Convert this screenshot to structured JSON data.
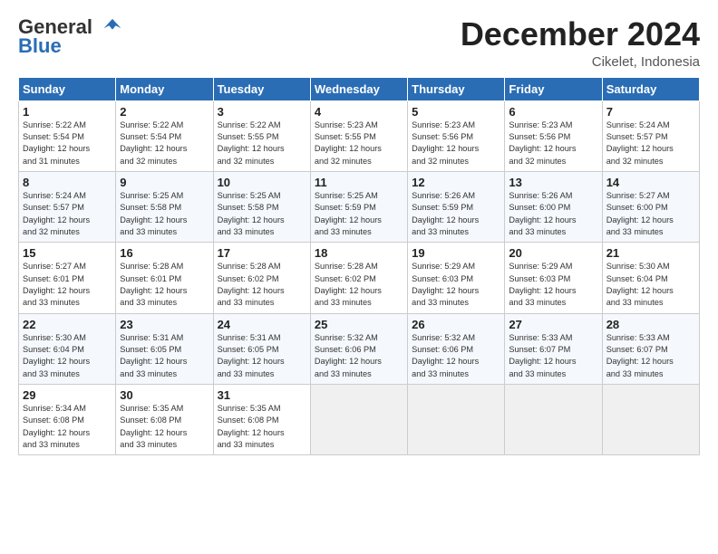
{
  "logo": {
    "line1": "General",
    "line2": "Blue"
  },
  "title": "December 2024",
  "location": "Cikelet, Indonesia",
  "days_of_week": [
    "Sunday",
    "Monday",
    "Tuesday",
    "Wednesday",
    "Thursday",
    "Friday",
    "Saturday"
  ],
  "weeks": [
    [
      {
        "day": "1",
        "sunrise": "5:22 AM",
        "sunset": "5:54 PM",
        "daylight": "12 hours and 31 minutes"
      },
      {
        "day": "2",
        "sunrise": "5:22 AM",
        "sunset": "5:54 PM",
        "daylight": "12 hours and 32 minutes"
      },
      {
        "day": "3",
        "sunrise": "5:22 AM",
        "sunset": "5:55 PM",
        "daylight": "12 hours and 32 minutes"
      },
      {
        "day": "4",
        "sunrise": "5:23 AM",
        "sunset": "5:55 PM",
        "daylight": "12 hours and 32 minutes"
      },
      {
        "day": "5",
        "sunrise": "5:23 AM",
        "sunset": "5:56 PM",
        "daylight": "12 hours and 32 minutes"
      },
      {
        "day": "6",
        "sunrise": "5:23 AM",
        "sunset": "5:56 PM",
        "daylight": "12 hours and 32 minutes"
      },
      {
        "day": "7",
        "sunrise": "5:24 AM",
        "sunset": "5:57 PM",
        "daylight": "12 hours and 32 minutes"
      }
    ],
    [
      {
        "day": "8",
        "sunrise": "5:24 AM",
        "sunset": "5:57 PM",
        "daylight": "12 hours and 32 minutes"
      },
      {
        "day": "9",
        "sunrise": "5:25 AM",
        "sunset": "5:58 PM",
        "daylight": "12 hours and 33 minutes"
      },
      {
        "day": "10",
        "sunrise": "5:25 AM",
        "sunset": "5:58 PM",
        "daylight": "12 hours and 33 minutes"
      },
      {
        "day": "11",
        "sunrise": "5:25 AM",
        "sunset": "5:59 PM",
        "daylight": "12 hours and 33 minutes"
      },
      {
        "day": "12",
        "sunrise": "5:26 AM",
        "sunset": "5:59 PM",
        "daylight": "12 hours and 33 minutes"
      },
      {
        "day": "13",
        "sunrise": "5:26 AM",
        "sunset": "6:00 PM",
        "daylight": "12 hours and 33 minutes"
      },
      {
        "day": "14",
        "sunrise": "5:27 AM",
        "sunset": "6:00 PM",
        "daylight": "12 hours and 33 minutes"
      }
    ],
    [
      {
        "day": "15",
        "sunrise": "5:27 AM",
        "sunset": "6:01 PM",
        "daylight": "12 hours and 33 minutes"
      },
      {
        "day": "16",
        "sunrise": "5:28 AM",
        "sunset": "6:01 PM",
        "daylight": "12 hours and 33 minutes"
      },
      {
        "day": "17",
        "sunrise": "5:28 AM",
        "sunset": "6:02 PM",
        "daylight": "12 hours and 33 minutes"
      },
      {
        "day": "18",
        "sunrise": "5:28 AM",
        "sunset": "6:02 PM",
        "daylight": "12 hours and 33 minutes"
      },
      {
        "day": "19",
        "sunrise": "5:29 AM",
        "sunset": "6:03 PM",
        "daylight": "12 hours and 33 minutes"
      },
      {
        "day": "20",
        "sunrise": "5:29 AM",
        "sunset": "6:03 PM",
        "daylight": "12 hours and 33 minutes"
      },
      {
        "day": "21",
        "sunrise": "5:30 AM",
        "sunset": "6:04 PM",
        "daylight": "12 hours and 33 minutes"
      }
    ],
    [
      {
        "day": "22",
        "sunrise": "5:30 AM",
        "sunset": "6:04 PM",
        "daylight": "12 hours and 33 minutes"
      },
      {
        "day": "23",
        "sunrise": "5:31 AM",
        "sunset": "6:05 PM",
        "daylight": "12 hours and 33 minutes"
      },
      {
        "day": "24",
        "sunrise": "5:31 AM",
        "sunset": "6:05 PM",
        "daylight": "12 hours and 33 minutes"
      },
      {
        "day": "25",
        "sunrise": "5:32 AM",
        "sunset": "6:06 PM",
        "daylight": "12 hours and 33 minutes"
      },
      {
        "day": "26",
        "sunrise": "5:32 AM",
        "sunset": "6:06 PM",
        "daylight": "12 hours and 33 minutes"
      },
      {
        "day": "27",
        "sunrise": "5:33 AM",
        "sunset": "6:07 PM",
        "daylight": "12 hours and 33 minutes"
      },
      {
        "day": "28",
        "sunrise": "5:33 AM",
        "sunset": "6:07 PM",
        "daylight": "12 hours and 33 minutes"
      }
    ],
    [
      {
        "day": "29",
        "sunrise": "5:34 AM",
        "sunset": "6:08 PM",
        "daylight": "12 hours and 33 minutes"
      },
      {
        "day": "30",
        "sunrise": "5:35 AM",
        "sunset": "6:08 PM",
        "daylight": "12 hours and 33 minutes"
      },
      {
        "day": "31",
        "sunrise": "5:35 AM",
        "sunset": "6:08 PM",
        "daylight": "12 hours and 33 minutes"
      },
      null,
      null,
      null,
      null
    ]
  ],
  "labels": {
    "sunrise": "Sunrise:",
    "sunset": "Sunset:",
    "daylight": "Daylight:"
  }
}
